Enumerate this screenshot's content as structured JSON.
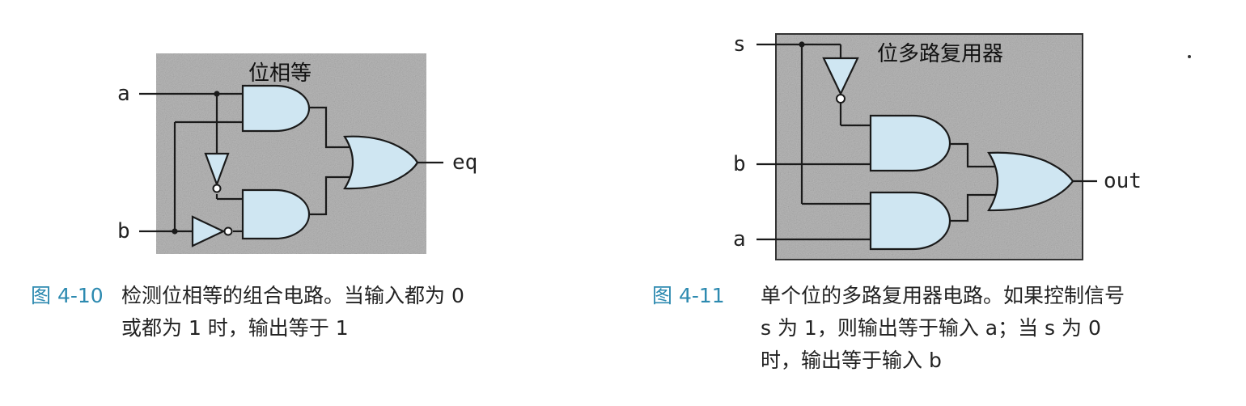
{
  "figure_10": {
    "title": "位相等",
    "inputs": {
      "a": "a",
      "b": "b"
    },
    "output": "eq",
    "caption_number": "图 4-10",
    "caption_lines": [
      "检测位相等的组合电路。当输入都为 0",
      "或都为 1 时，输出等于 1"
    ]
  },
  "figure_11": {
    "title": "位多路复用器",
    "inputs": {
      "s": "s",
      "b": "b",
      "a": "a"
    },
    "output": "out",
    "caption_number": "图 4-11",
    "caption_lines": [
      "单个位的多路复用器电路。如果控制信号",
      "s 为 1，则输出等于输入 a；当 s 为 0",
      "时，输出等于输入 b"
    ]
  },
  "colors": {
    "panel": "#b9b9b9",
    "gate_fill": "#cfe6f2",
    "wire": "#1a1a1a",
    "caption_number": "#2d8ab0"
  }
}
